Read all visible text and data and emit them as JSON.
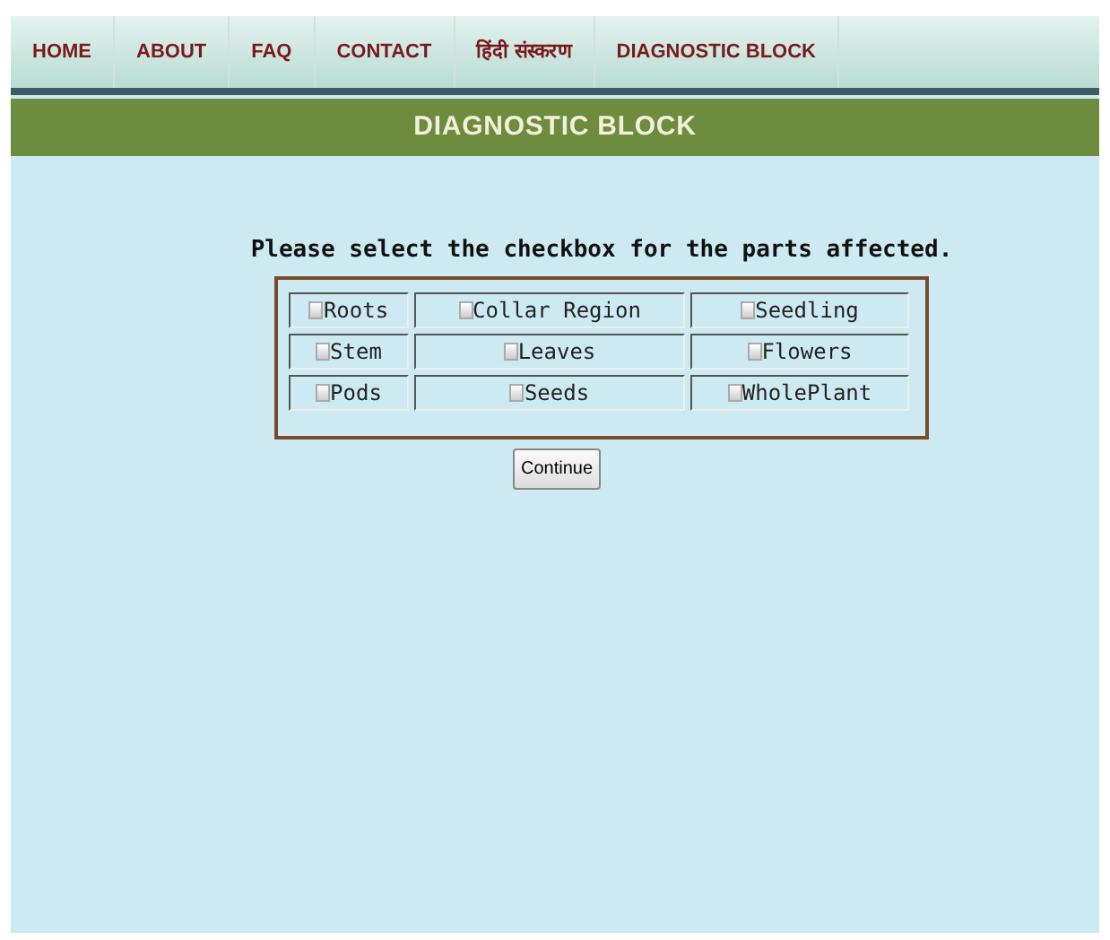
{
  "nav": [
    {
      "label": "HOME",
      "selected": false
    },
    {
      "label": "ABOUT",
      "selected": false
    },
    {
      "label": "FAQ",
      "selected": false
    },
    {
      "label": "CONTACT",
      "selected": false
    },
    {
      "label": "हिंदी संस्करण",
      "selected": false
    },
    {
      "label": "DIAGNOSTIC BLOCK",
      "selected": false
    }
  ],
  "header": {
    "title": "DIAGNOSTIC BLOCK"
  },
  "instruction": "Please select the checkbox for the parts affected.",
  "parts": [
    {
      "label": "Roots",
      "checked": false
    },
    {
      "label": "Collar Region",
      "checked": false
    },
    {
      "label": "Seedling",
      "checked": false
    },
    {
      "label": "Stem",
      "checked": false
    },
    {
      "label": "Leaves",
      "checked": false
    },
    {
      "label": "Flowers",
      "checked": false
    },
    {
      "label": "Pods",
      "checked": false
    },
    {
      "label": "Seeds",
      "checked": false
    },
    {
      "label": "WholePlant",
      "checked": false
    }
  ],
  "buttons": [
    "Continue"
  ]
}
